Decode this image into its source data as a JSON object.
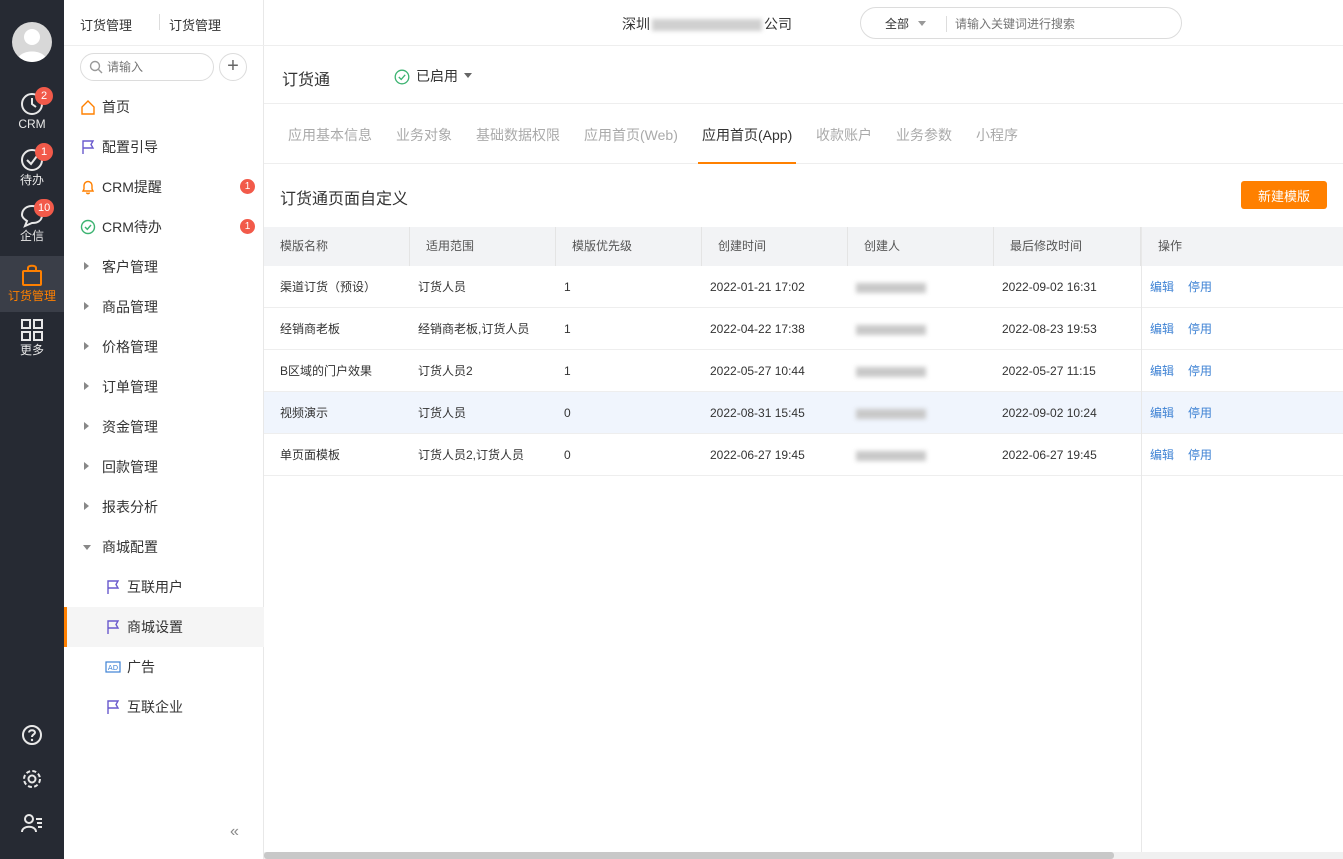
{
  "rail": {
    "items": [
      {
        "label": "CRM",
        "badge": "2",
        "icon": "clock-icon"
      },
      {
        "label": "待办",
        "badge": "1",
        "icon": "check-circle-icon"
      },
      {
        "label": "企信",
        "badge": "10",
        "icon": "chat-bubble-icon"
      },
      {
        "label": "订货管理",
        "badge": "",
        "icon": "shopping-bag-icon"
      },
      {
        "label": "更多",
        "badge": "",
        "icon": "grid-icon"
      }
    ],
    "bottom_icons": [
      "help-icon",
      "settings-icon",
      "user-list-icon"
    ]
  },
  "nav": {
    "header_title": "订货管理",
    "header_sub": "订货管理",
    "search_placeholder": "请输入",
    "add_label": "+",
    "items": [
      {
        "label": "首页",
        "icon": "home-icon",
        "badge": ""
      },
      {
        "label": "配置引导",
        "icon": "flag-icon",
        "badge": ""
      },
      {
        "label": "CRM提醒",
        "icon": "bell-icon",
        "badge": "1"
      },
      {
        "label": "CRM待办",
        "icon": "check-circle-icon",
        "badge": "1"
      },
      {
        "label": "客户管理",
        "icon": "caret-right-icon",
        "badge": ""
      },
      {
        "label": "商品管理",
        "icon": "caret-right-icon",
        "badge": ""
      },
      {
        "label": "价格管理",
        "icon": "caret-right-icon",
        "badge": ""
      },
      {
        "label": "订单管理",
        "icon": "caret-right-icon",
        "badge": ""
      },
      {
        "label": "资金管理",
        "icon": "caret-right-icon",
        "badge": ""
      },
      {
        "label": "回款管理",
        "icon": "caret-right-icon",
        "badge": ""
      },
      {
        "label": "报表分析",
        "icon": "caret-right-icon",
        "badge": ""
      },
      {
        "label": "商城配置",
        "icon": "caret-down-icon",
        "badge": ""
      }
    ],
    "sub_items": [
      {
        "label": "互联用户",
        "icon": "flag-icon"
      },
      {
        "label": "商城设置",
        "icon": "flag-icon",
        "selected": true
      },
      {
        "label": "广告",
        "icon": "ad-icon"
      },
      {
        "label": "互联企业",
        "icon": "flag-icon"
      }
    ],
    "collapse_label": "«"
  },
  "top": {
    "company_left": "深圳",
    "company_right": "公司",
    "search_scope": "全部",
    "search_placeholder": "请输入关键词进行搜索"
  },
  "app": {
    "name": "订货通",
    "status": "已启用"
  },
  "tabs": [
    {
      "label": "应用基本信息",
      "active": false
    },
    {
      "label": "业务对象",
      "active": false
    },
    {
      "label": "基础数据权限",
      "active": false
    },
    {
      "label": "应用首页(Web)",
      "active": false
    },
    {
      "label": "应用首页(App)",
      "active": true
    },
    {
      "label": "收款账户",
      "active": false
    },
    {
      "label": "业务参数",
      "active": false
    },
    {
      "label": "小程序",
      "active": false
    }
  ],
  "section": {
    "title": "订货通页面自定义",
    "new_button": "新建模版"
  },
  "table": {
    "columns": [
      "模版名称",
      "适用范围",
      "模版优先级",
      "创建时间",
      "创建人",
      "最后修改时间",
      "操作"
    ],
    "rows": [
      {
        "name": "渠道订货（预设）",
        "scope": "订货人员",
        "priority": "1",
        "created": "2022-01-21 17:02",
        "creator": "",
        "modified": "2022-09-02 16:31"
      },
      {
        "name": "经销商老板",
        "scope": "经销商老板,订货人员",
        "priority": "1",
        "created": "2022-04-22 17:38",
        "creator": "",
        "modified": "2022-08-23 19:53"
      },
      {
        "name": "B区域的门户效果",
        "scope": "订货人员2",
        "priority": "1",
        "created": "2022-05-27 10:44",
        "creator": "",
        "modified": "2022-05-27 11:15"
      },
      {
        "name": "视频演示",
        "scope": "订货人员",
        "priority": "0",
        "created": "2022-08-31 15:45",
        "creator": "",
        "modified": "2022-09-02 10:24"
      },
      {
        "name": "单页面模板",
        "scope": "订货人员2,订货人员",
        "priority": "0",
        "created": "2022-06-27 19:45",
        "creator": "",
        "modified": "2022-06-27 19:45"
      }
    ],
    "edit_label": "编辑",
    "disable_label": "停用"
  },
  "colors": {
    "accent": "#ff8000",
    "link": "#3e82d4",
    "rail_bg": "#262a33",
    "badge": "#f25a4a"
  }
}
